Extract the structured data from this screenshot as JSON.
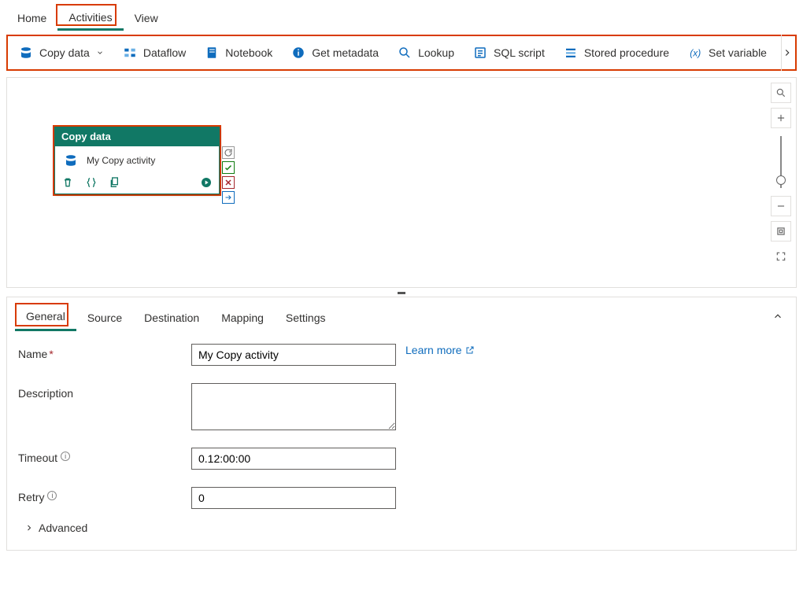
{
  "topnav": {
    "home": "Home",
    "activities": "Activities",
    "view": "View"
  },
  "ribbon": {
    "copy_data": "Copy data",
    "dataflow": "Dataflow",
    "notebook": "Notebook",
    "get_metadata": "Get metadata",
    "lookup": "Lookup",
    "sql_script": "SQL script",
    "stored_procedure": "Stored procedure",
    "set_variable": "Set variable"
  },
  "activity": {
    "title": "Copy data",
    "name": "My Copy activity"
  },
  "detail_tabs": {
    "general": "General",
    "source": "Source",
    "destination": "Destination",
    "mapping": "Mapping",
    "settings": "Settings"
  },
  "general_form": {
    "name_label": "Name",
    "name_value": "My Copy activity",
    "learn_more": "Learn more",
    "description_label": "Description",
    "description_value": "",
    "timeout_label": "Timeout",
    "timeout_value": "0.12:00:00",
    "retry_label": "Retry",
    "retry_value": "0",
    "advanced": "Advanced"
  }
}
